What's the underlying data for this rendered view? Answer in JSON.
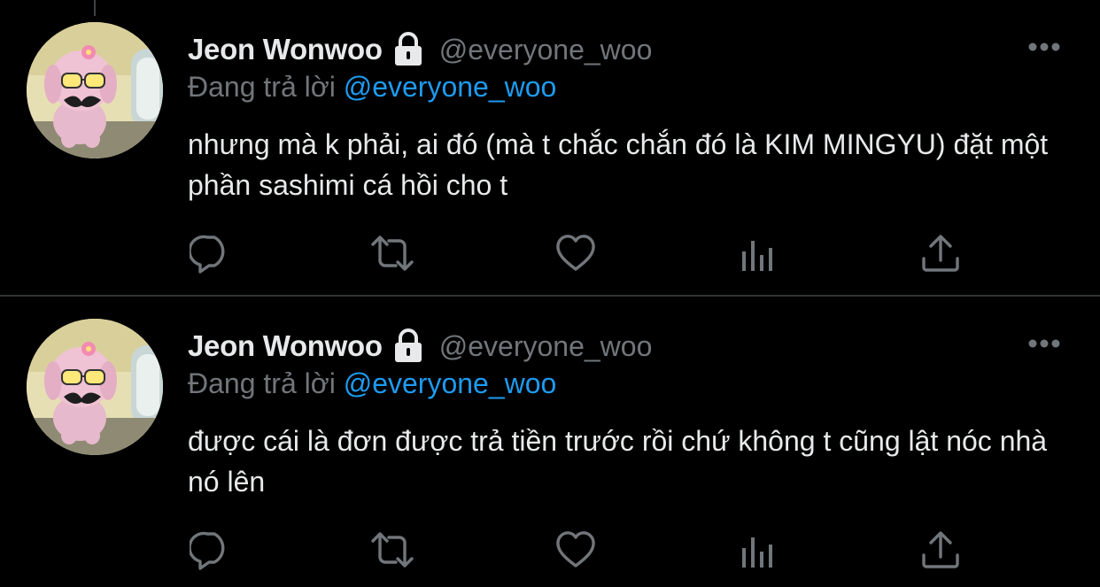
{
  "colors": {
    "background": "#000000",
    "primary_text": "#e7e9ea",
    "secondary_text": "#71767b",
    "mention": "#1d9bf0",
    "divider": "#2f3336"
  },
  "tweets": [
    {
      "author_name": "Jeon Wonwoo",
      "author_handle": "@everyone_woo",
      "protected_icon": "lock-icon",
      "reply_prefix": "Đang trả lời",
      "reply_to": "@everyone_woo",
      "text": "nhưng mà k phải, ai đó (mà t chắc chắn đó là KIM MINGYU) đặt một phần sashimi cá hồi cho t",
      "actions": [
        "reply-icon",
        "retweet-icon",
        "like-icon",
        "analytics-icon",
        "share-icon"
      ]
    },
    {
      "author_name": "Jeon Wonwoo",
      "author_handle": "@everyone_woo",
      "protected_icon": "lock-icon",
      "reply_prefix": "Đang trả lời",
      "reply_to": "@everyone_woo",
      "text": "được cái là đơn được trả tiền trước rồi chứ không t cũng lật nóc nhà nó lên",
      "actions": [
        "reply-icon",
        "retweet-icon",
        "like-icon",
        "analytics-icon",
        "share-icon"
      ]
    }
  ]
}
